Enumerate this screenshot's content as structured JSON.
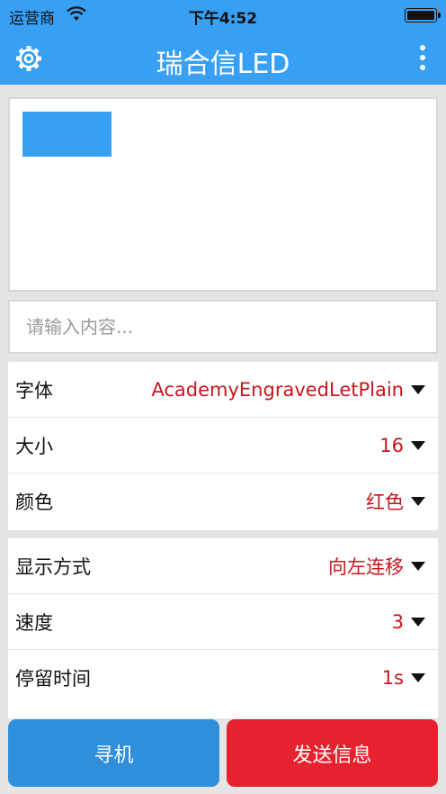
{
  "status_bar": {
    "carrier": "运营商",
    "time": "下午4:52"
  },
  "nav": {
    "title": "瑞合信LED",
    "left_icon": "gear-icon",
    "right_icon": "more-vertical-icon"
  },
  "preview": {
    "block_color": "#37a0f5"
  },
  "input": {
    "placeholder": "请输入内容..."
  },
  "settings_group1": [
    {
      "label": "字体",
      "value": "AcademyEngravedLetPlain"
    },
    {
      "label": "大小",
      "value": "16"
    },
    {
      "label": "颜色",
      "value": "红色"
    }
  ],
  "settings_group2": [
    {
      "label": "显示方式",
      "value": "向左连移"
    },
    {
      "label": "速度",
      "value": "3"
    },
    {
      "label": "停留时间",
      "value": "1s"
    }
  ],
  "buttons": {
    "search": "寻机",
    "send": "发送信息"
  },
  "colors": {
    "primary": "#37a0f5",
    "value_text": "#c8161d",
    "send_button": "#e7222e"
  }
}
